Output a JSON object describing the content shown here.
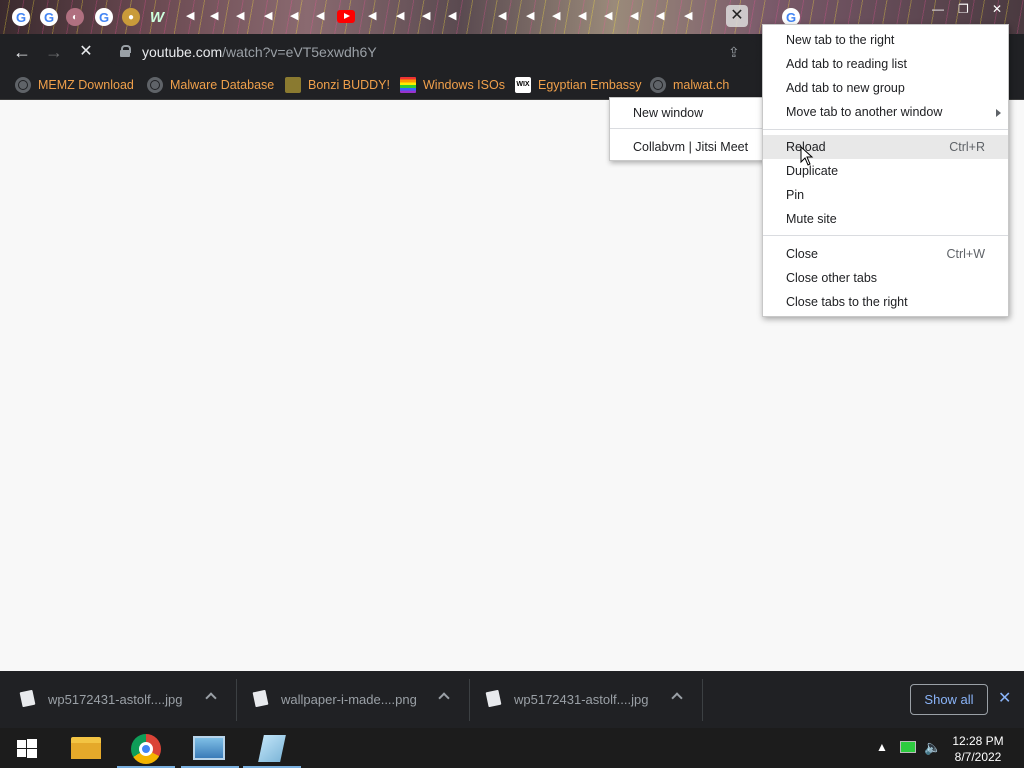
{
  "browser": {
    "url_domain": "youtube.com",
    "url_path": "/watch?v=eVT5exwdh6Y",
    "bookmarks": [
      {
        "label": "MEMZ Download",
        "icon": "globe-icon"
      },
      {
        "label": "Malware Database",
        "icon": "globe-icon"
      },
      {
        "label": "Bonzi BUDDY!",
        "icon": "bonzi-icon"
      },
      {
        "label": "Windows ISOs",
        "icon": "rainbow-flag-icon"
      },
      {
        "label": "Egyptian Embassy",
        "icon": "wix-icon"
      },
      {
        "label": "malwat.ch",
        "icon": "globe-icon"
      }
    ]
  },
  "submenu": {
    "items": [
      {
        "label": "New window"
      },
      {
        "label": "Collabvm | Jitsi Meet"
      }
    ]
  },
  "context_menu": {
    "items": [
      {
        "label": "New tab to the right",
        "shortcut": ""
      },
      {
        "label": "Add tab to reading list",
        "shortcut": ""
      },
      {
        "label": "Add tab to new group",
        "shortcut": ""
      },
      {
        "label": "Move tab to another window",
        "shortcut": "",
        "has_submenu": true
      },
      {
        "label": "Reload",
        "shortcut": "Ctrl+R",
        "hovered": true
      },
      {
        "label": "Duplicate",
        "shortcut": ""
      },
      {
        "label": "Pin",
        "shortcut": ""
      },
      {
        "label": "Mute site",
        "shortcut": ""
      },
      {
        "label": "Close",
        "shortcut": "Ctrl+W"
      },
      {
        "label": "Close other tabs",
        "shortcut": ""
      },
      {
        "label": "Close tabs to the right",
        "shortcut": ""
      }
    ]
  },
  "downloads": {
    "items": [
      {
        "file_name": "wp5172431-astolf....jpg"
      },
      {
        "file_name": "wallpaper-i-made....png"
      },
      {
        "file_name": "wp5172431-astolf....jpg"
      }
    ],
    "show_all_label": "Show all"
  },
  "taskbar": {
    "time": "12:28 PM",
    "date": "8/7/2022"
  },
  "colors": {
    "bookmark_text": "#f0a04b",
    "toolbar_bg": "#202124",
    "link_blue": "#8ab4f8"
  }
}
